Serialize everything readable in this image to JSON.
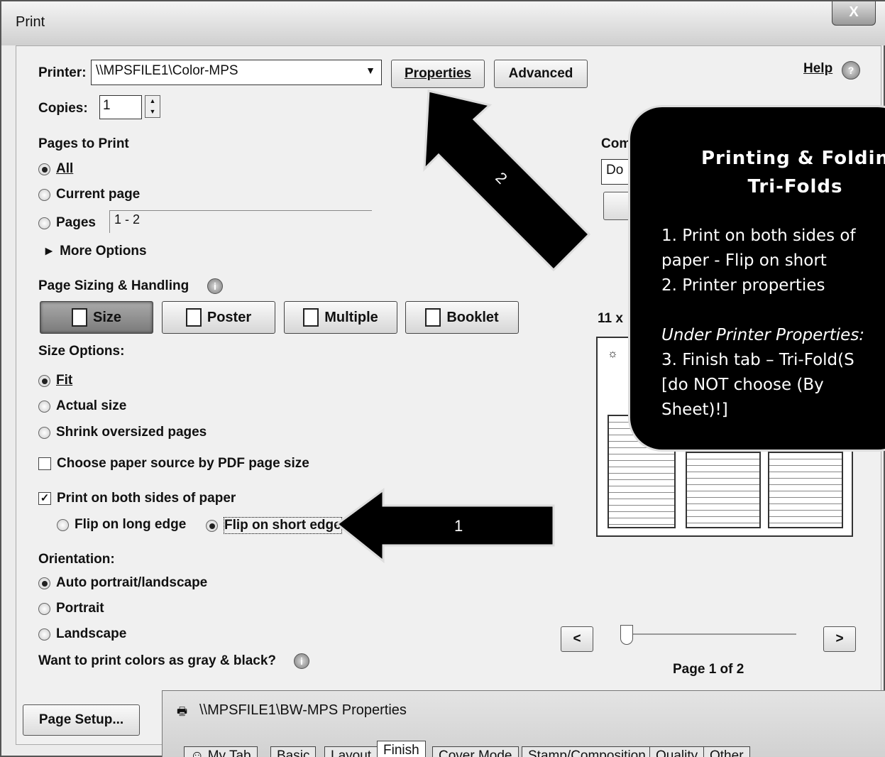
{
  "window": {
    "title": "Print",
    "close_label": "X"
  },
  "printer": {
    "label": "Printer:",
    "value": "\\\\MPSFILE1\\Color-MPS",
    "properties_label": "Properties",
    "advanced_label": "Advanced",
    "help_label": "Help"
  },
  "copies": {
    "label": "Copies:",
    "value": "1"
  },
  "pages_to_print": {
    "heading": "Pages to Print",
    "all": "All",
    "current": "Current page",
    "pages": "Pages",
    "pages_value": "1 - 2",
    "more_options": "More Options"
  },
  "sizing": {
    "heading": "Page Sizing & Handling",
    "tabs": [
      "Size",
      "Poster",
      "Multiple",
      "Booklet"
    ],
    "size_options_label": "Size Options:",
    "fit": "Fit",
    "actual": "Actual size",
    "shrink": "Shrink oversized pages",
    "paper_source": "Choose paper source by PDF page size",
    "both_sides": "Print on both sides of paper",
    "flip_long": "Flip on long edge",
    "flip_short": "Flip on short edge"
  },
  "orientation": {
    "label": "Orientation:",
    "auto": "Auto portrait/landscape",
    "portrait": "Portrait",
    "landscape": "Landscape"
  },
  "gray_question": "Want to print colors as gray & black?",
  "right": {
    "comments_label": "Com",
    "doc_value": "Do",
    "size_label": "11 x",
    "page_label": "Page 1 of 2",
    "prev": "<",
    "next": ">"
  },
  "page_setup_label": "Page Setup...",
  "overlay": {
    "title_line1": "Printing & Foldin",
    "title_line2": "Tri-Folds",
    "items": [
      "1.  Print on both sides of",
      "     paper - Flip on short",
      "2.  Printer properties",
      "Under Printer Properties:",
      "3.  Finish tab – Tri-Fold(S",
      "     [do NOT choose (By",
      "     Sheet)!]"
    ]
  },
  "arrows": {
    "a1": "1",
    "a2": "2"
  },
  "props_dialog": {
    "title": "\\\\MPSFILE1\\BW-MPS Properties",
    "tabs": [
      "My Tab",
      "Basic",
      "Layout",
      "Finish",
      "Cover Mode",
      "Stamp/Composition",
      "Quality",
      "Other"
    ]
  }
}
